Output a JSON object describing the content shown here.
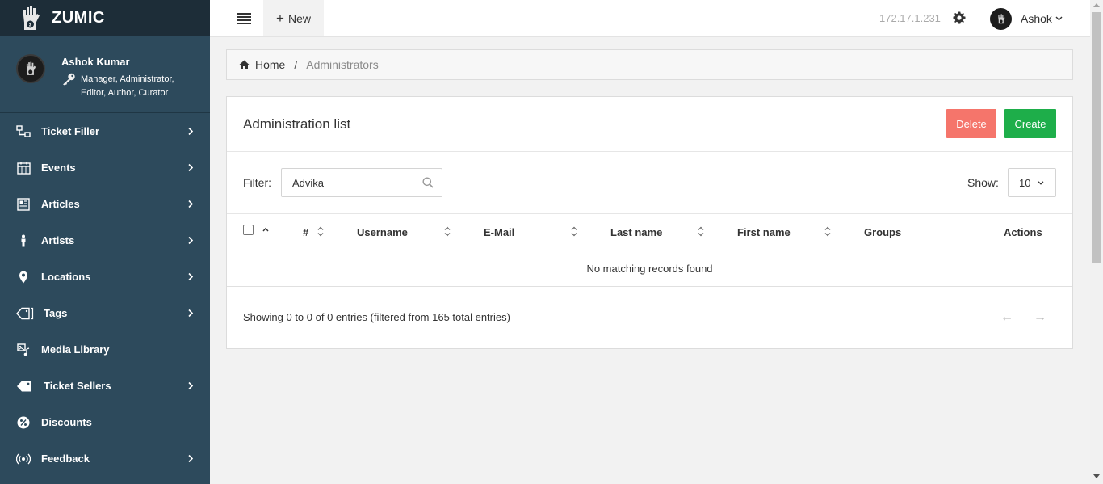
{
  "brand": {
    "name": "ZUMIC"
  },
  "user": {
    "name": "Ashok Kumar",
    "roles": "Manager, Administrator, Editor, Author, Curator",
    "short_name": "Ashok"
  },
  "sidebar": {
    "items": [
      {
        "label": "Ticket Filler",
        "icon": "sitemap-icon",
        "has_children": true
      },
      {
        "label": "Events",
        "icon": "calendar-icon",
        "has_children": true
      },
      {
        "label": "Articles",
        "icon": "newspaper-icon",
        "has_children": true
      },
      {
        "label": "Artists",
        "icon": "person-icon",
        "has_children": true
      },
      {
        "label": "Locations",
        "icon": "map-pin-icon",
        "has_children": true
      },
      {
        "label": "Tags",
        "icon": "tags-icon",
        "has_children": true
      },
      {
        "label": "Media Library",
        "icon": "media-icon",
        "has_children": false
      },
      {
        "label": "Ticket Sellers",
        "icon": "tag-icon",
        "has_children": true
      },
      {
        "label": "Discounts",
        "icon": "percent-icon",
        "has_children": false
      },
      {
        "label": "Feedback",
        "icon": "broadcast-icon",
        "has_children": true
      }
    ]
  },
  "topbar": {
    "new_label": "New",
    "ip": "172.17.1.231"
  },
  "breadcrumb": {
    "home": "Home",
    "separator": "/",
    "current": "Administrators"
  },
  "card": {
    "title": "Administration list",
    "delete_label": "Delete",
    "create_label": "Create"
  },
  "filter": {
    "label": "Filter:",
    "value": "Advika",
    "show_label": "Show:",
    "show_value": "10"
  },
  "table": {
    "columns": [
      "#",
      "Username",
      "E-Mail",
      "Last name",
      "First name",
      "Groups",
      "Actions"
    ],
    "empty_message": "No matching records found"
  },
  "footer": {
    "info": "Showing 0 to 0 of 0 entries (filtered from 165 total entries)",
    "prev": "←",
    "next": "→"
  },
  "colors": {
    "sidebar": "#2d4a5c",
    "brand_bar": "#1d2d38",
    "delete": "#f5756b",
    "create": "#1eae4a"
  }
}
